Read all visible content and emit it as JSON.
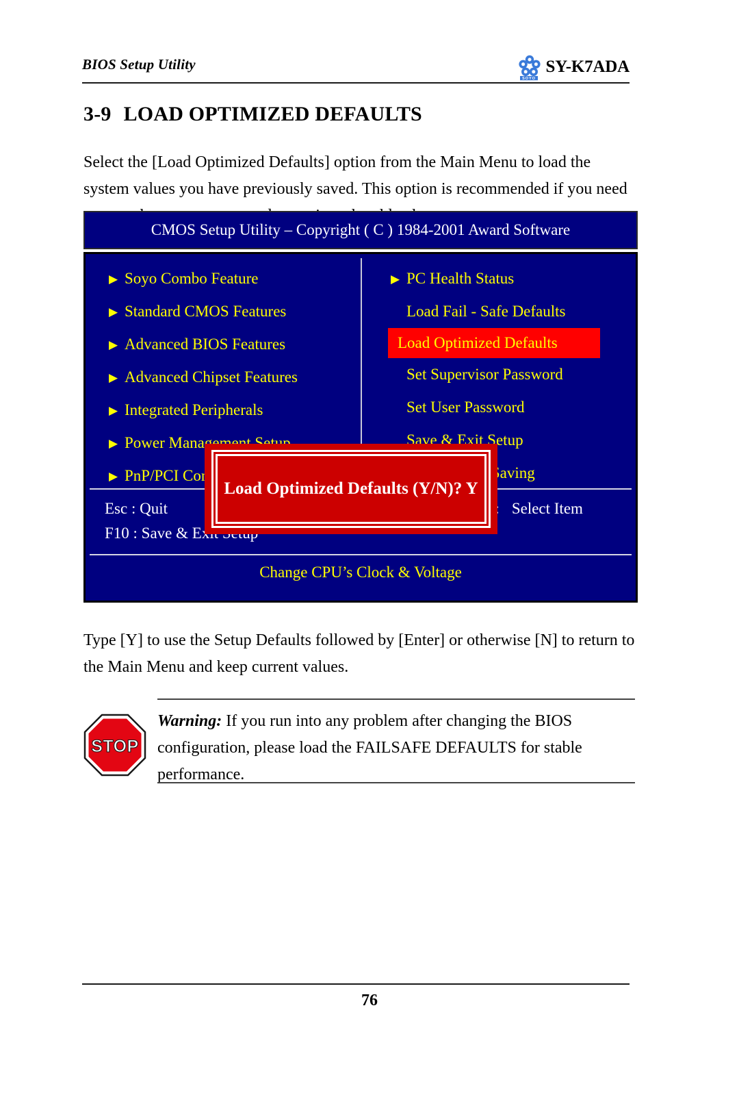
{
  "header": {
    "running_title": "BIOS Setup Utility",
    "model": "SY-K7ADA",
    "logo_wordmark": "SOYO"
  },
  "section": {
    "number": "3-9",
    "title": "LOAD OPTIMIZED DEFAULTS",
    "intro": "Select the [Load Optimized Defaults] option from the Main Menu to load the system values you have previously saved. This option is recommended if you need to reset the system setup and to retrieve the old values.",
    "post": "Type [Y] to use the Setup Defaults followed by [Enter] or otherwise [N] to return to the Main Menu and keep current values."
  },
  "bios": {
    "title": "CMOS Setup Utility – Copyright ( C ) 1984-2001 Award Software",
    "left_menu": [
      {
        "label": "Soyo Combo Feature",
        "bullet": true
      },
      {
        "label": "Standard CMOS Features",
        "bullet": true
      },
      {
        "label": "Advanced BIOS Features",
        "bullet": true
      },
      {
        "label": "Advanced Chipset Features",
        "bullet": true
      },
      {
        "label": "Integrated Peripherals",
        "bullet": true
      },
      {
        "label": "Power Management Setup",
        "bullet": true
      },
      {
        "label": "PnP/PCI Configurations",
        "bullet": true
      }
    ],
    "right_menu": [
      {
        "label": "PC Health Status",
        "bullet": true,
        "highlight": false
      },
      {
        "label": "Load Fail - Safe Defaults",
        "bullet": false,
        "highlight": false
      },
      {
        "label": "Load Optimized Defaults",
        "bullet": false,
        "highlight": true
      },
      {
        "label": "Set Supervisor Password",
        "bullet": false,
        "highlight": false
      },
      {
        "label": "Set User Password",
        "bullet": false,
        "highlight": false
      },
      {
        "label": "Save & Exit Setup",
        "bullet": false,
        "highlight": false
      },
      {
        "label": "Exit Without Saving",
        "bullet": false,
        "highlight": false
      }
    ],
    "keys": {
      "quit": "Esc : Quit",
      "save_exit": "F10 : Save & Exit Setup",
      "arrows": "↑↓→←",
      "colon": ":",
      "select_item": "Select Item"
    },
    "footer_hint": "Change CPU’s Clock & Voltage",
    "dialog": {
      "text": "Load Optimized Defaults (Y/N)? Y"
    },
    "colors": {
      "screen_background": "#000080",
      "menu_text": "#ffff00",
      "highlight_background": "#ff0000",
      "dialog_background": "#cc0000",
      "dialog_text": "#ffffff"
    }
  },
  "warning": {
    "label": "Warning:",
    "body": " If you run into any problem after changing the BIOS configuration, please load the FAILSAFE DEFAULTS for stable performance.",
    "icon_text": "STOP",
    "icon_color": "#e30613"
  },
  "footer": {
    "page_number": "76"
  }
}
